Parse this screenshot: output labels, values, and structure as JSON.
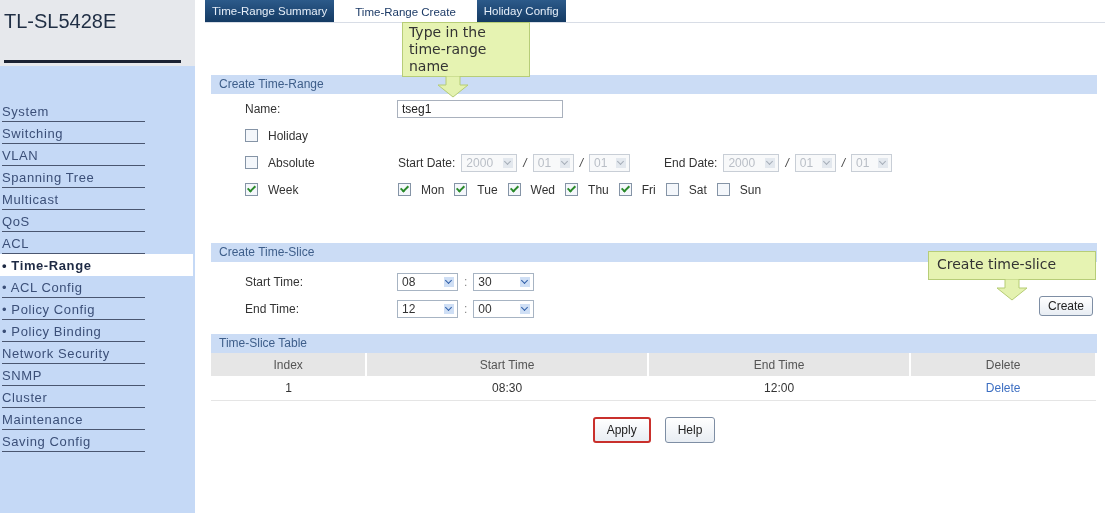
{
  "device": {
    "model": "TL-SL5428E"
  },
  "sidebar": {
    "items": [
      {
        "label": "System",
        "selected": false
      },
      {
        "label": "Switching",
        "selected": false
      },
      {
        "label": "VLAN",
        "selected": false
      },
      {
        "label": "Spanning Tree",
        "selected": false
      },
      {
        "label": "Multicast",
        "selected": false
      },
      {
        "label": "QoS",
        "selected": false
      },
      {
        "label": "ACL",
        "selected": false
      },
      {
        "label": "• Time-Range",
        "selected": true
      },
      {
        "label": "• ACL Config",
        "selected": false
      },
      {
        "label": "• Policy Config",
        "selected": false
      },
      {
        "label": "• Policy Binding",
        "selected": false
      },
      {
        "label": "Network Security",
        "selected": false
      },
      {
        "label": "SNMP",
        "selected": false
      },
      {
        "label": "Cluster",
        "selected": false
      },
      {
        "label": "Maintenance",
        "selected": false
      },
      {
        "label": "Saving Config",
        "selected": false
      }
    ]
  },
  "tabs": [
    {
      "label": "Time-Range Summary",
      "selected": false
    },
    {
      "label": "Time-Range Create",
      "selected": true
    },
    {
      "label": "Holiday Config",
      "selected": false
    }
  ],
  "create_time_range": {
    "title": "Create Time-Range",
    "name": {
      "label": "Name:",
      "value": "tseg1"
    },
    "holiday": {
      "label": "Holiday",
      "checked": false
    },
    "absolute": {
      "label": "Absolute",
      "checked": false,
      "start_date": {
        "label": "Start Date:",
        "disabled": true,
        "fields": [
          "2000",
          "01",
          "01"
        ]
      },
      "end_date": {
        "label": "End Date:",
        "disabled": true,
        "fields": [
          "2000",
          "01",
          "01"
        ]
      },
      "separators": [
        "/",
        "/",
        "/",
        "/"
      ]
    },
    "week": {
      "label": "Week",
      "checked": true,
      "days": [
        {
          "label": "Mon",
          "checked": true
        },
        {
          "label": "Tue",
          "checked": true
        },
        {
          "label": "Wed",
          "checked": true
        },
        {
          "label": "Thu",
          "checked": true
        },
        {
          "label": "Fri",
          "checked": true
        },
        {
          "label": "Sat",
          "checked": false
        },
        {
          "label": "Sun",
          "checked": false
        }
      ]
    }
  },
  "create_time_slice": {
    "title": "Create Time-Slice",
    "times": [
      {
        "label": "Start Time:",
        "hour": "08",
        "separator": ":",
        "minute": "30"
      },
      {
        "label": "End Time:",
        "hour": "12",
        "separator": ":",
        "minute": "00"
      }
    ],
    "create_button": "Create"
  },
  "time_slice_table": {
    "title": "Time-Slice Table",
    "columns": [
      "Index",
      "Start Time",
      "End Time",
      "Delete"
    ],
    "rows": [
      {
        "index": "1",
        "start_time": "08:30",
        "end_time": "12:00",
        "delete": "Delete"
      }
    ]
  },
  "buttons": [
    {
      "label": "Apply",
      "focused": true
    },
    {
      "label": "Help",
      "focused": false
    }
  ],
  "callouts": [
    {
      "lines": [
        "Type in the",
        "time-range name"
      ]
    },
    {
      "lines": [
        "Create time-slice"
      ]
    }
  ]
}
